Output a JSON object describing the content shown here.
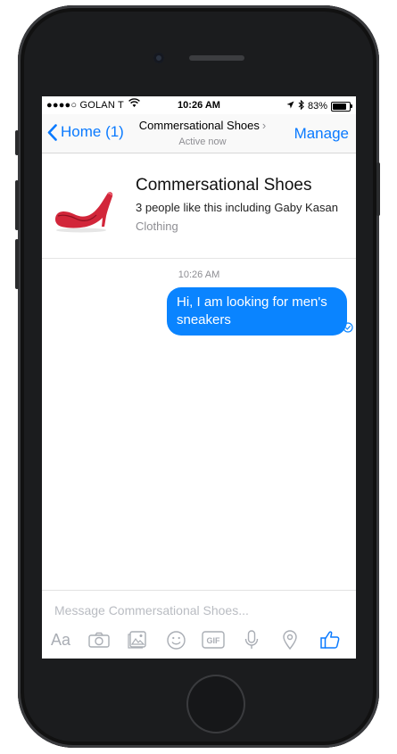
{
  "status_bar": {
    "carrier": "●●●●○ GOLAN T",
    "time": "10:26 AM",
    "battery": "83%",
    "battery_level": 0.83
  },
  "nav": {
    "back_label": "Home (1)",
    "title": "Commersational Shoes",
    "subtitle": "Active now",
    "manage_label": "Manage"
  },
  "profile": {
    "name": "Commersational Shoes",
    "likes": "3 people like this including Gaby Kasan",
    "category": "Clothing"
  },
  "conversation": {
    "timestamp": "10:26 AM",
    "message": "Hi, I am looking for men's sneakers"
  },
  "composer": {
    "placeholder": "Message Commersational Shoes...",
    "text_tool": "Aa",
    "icons": [
      "camera-icon",
      "photo-icon",
      "emoji-icon",
      "gif-icon",
      "microphone-icon",
      "location-icon",
      "thumbs-up-icon"
    ]
  },
  "colors": {
    "accent": "#0a7aff",
    "bubble": "#0a84ff",
    "icon_gray": "#a9adb4"
  }
}
